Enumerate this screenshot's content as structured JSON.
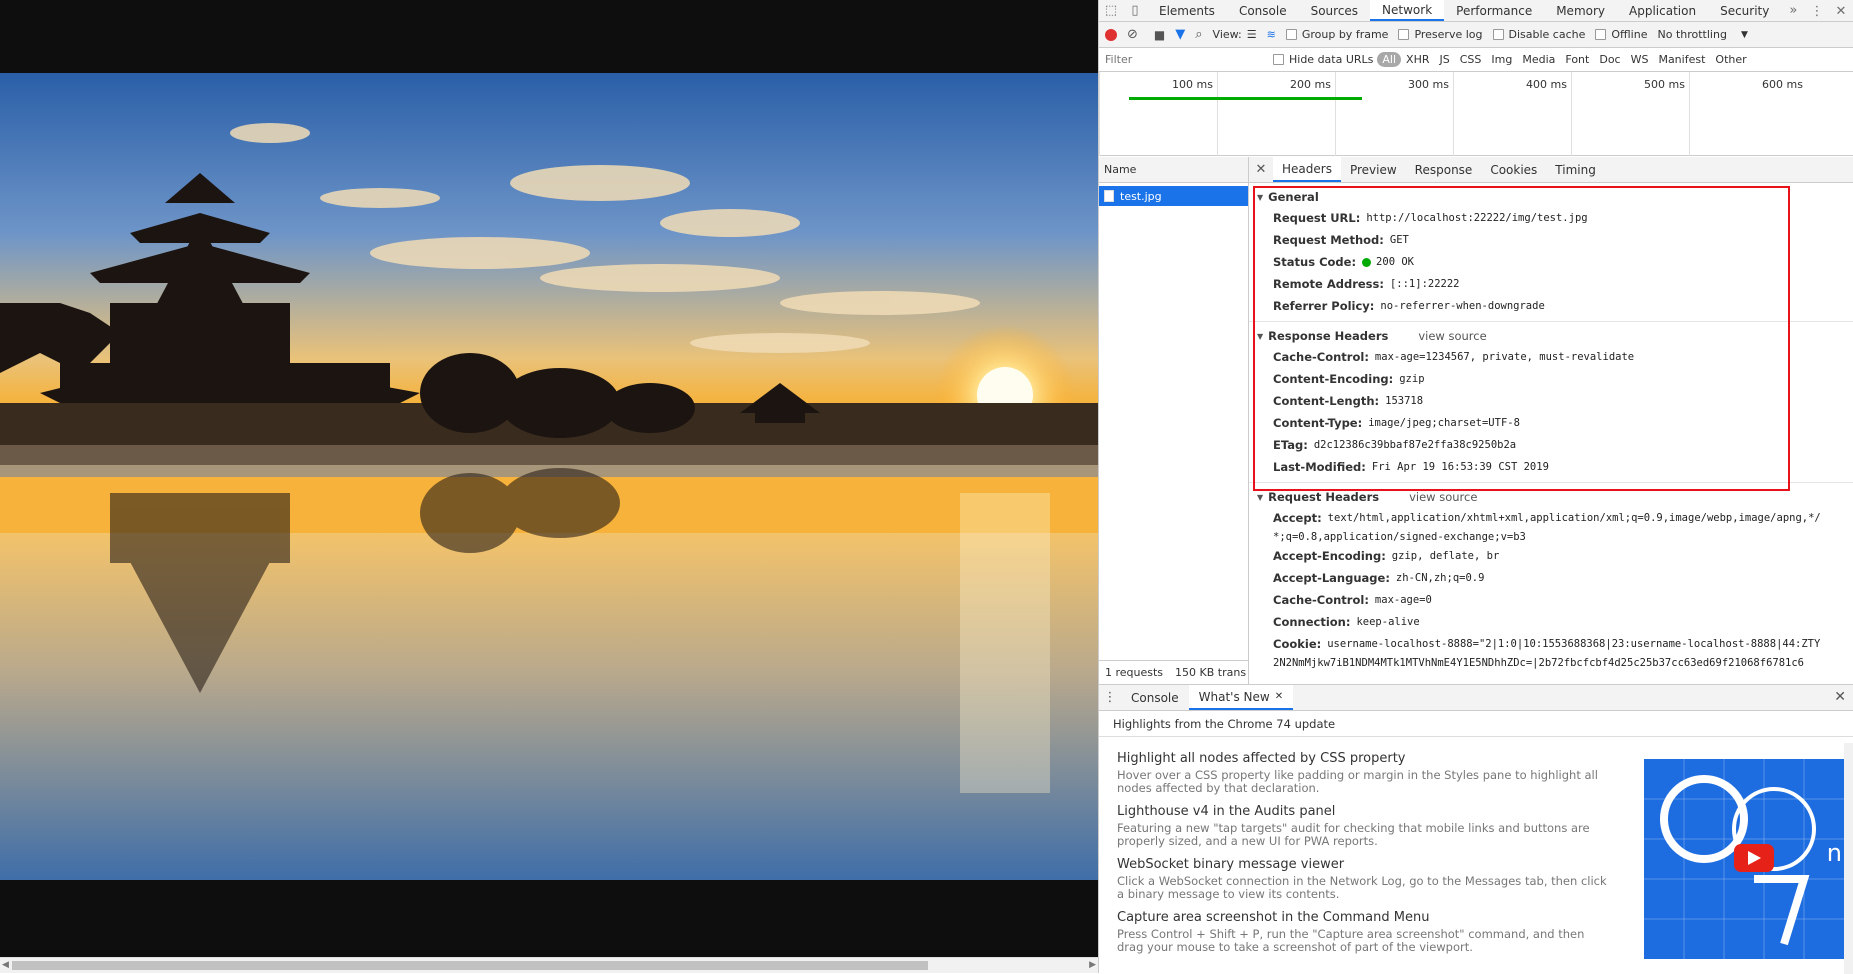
{
  "devtools": {
    "tabs": [
      "Elements",
      "Console",
      "Sources",
      "Network",
      "Performance",
      "Memory",
      "Application",
      "Security"
    ],
    "active_tab": "Network",
    "overflow": "»",
    "more": "⋮",
    "close": "✕",
    "toolbar": {
      "view_label": "View:",
      "group_by_frame": "Group by frame",
      "preserve_log": "Preserve log",
      "disable_cache": "Disable cache",
      "offline": "Offline",
      "throttling": "No throttling"
    },
    "filter": {
      "placeholder": "Filter",
      "hide_data_urls": "Hide data URLs",
      "types": [
        "All",
        "XHR",
        "JS",
        "CSS",
        "Img",
        "Media",
        "Font",
        "Doc",
        "WS",
        "Manifest",
        "Other"
      ]
    },
    "overview_ticks": [
      "100 ms",
      "200 ms",
      "300 ms",
      "400 ms",
      "500 ms",
      "600 ms"
    ],
    "requests": {
      "name_header": "Name",
      "rows": [
        {
          "name": "test.jpg"
        }
      ],
      "status": [
        "1 requests",
        "150 KB trans"
      ]
    },
    "detail_tabs": [
      "Headers",
      "Preview",
      "Response",
      "Cookies",
      "Timing"
    ],
    "active_detail_tab": "Headers",
    "general": {
      "title": "General",
      "rows": [
        {
          "key": "Request URL:",
          "value": "http://localhost:22222/img/test.jpg"
        },
        {
          "key": "Request Method:",
          "value": "GET"
        },
        {
          "key": "Status Code:",
          "value": "200 OK"
        },
        {
          "key": "Remote Address:",
          "value": "[::1]:22222"
        },
        {
          "key": "Referrer Policy:",
          "value": "no-referrer-when-downgrade"
        }
      ]
    },
    "response_headers": {
      "title": "Response Headers",
      "view_source": "view source",
      "rows": [
        {
          "key": "Cache-Control:",
          "value": "max-age=1234567, private, must-revalidate"
        },
        {
          "key": "Content-Encoding:",
          "value": "gzip"
        },
        {
          "key": "Content-Length:",
          "value": "153718"
        },
        {
          "key": "Content-Type:",
          "value": "image/jpeg;charset=UTF-8"
        },
        {
          "key": "ETag:",
          "value": "d2c12386c39bbaf87e2ffa38c9250b2a"
        },
        {
          "key": "Last-Modified:",
          "value": "Fri Apr 19 16:53:39 CST 2019"
        }
      ]
    },
    "request_headers": {
      "title": "Request Headers",
      "view_source": "view source",
      "accept_key": "Accept:",
      "accept_value": "text/html,application/xhtml+xml,application/xml;q=0.9,image/webp,image/apng,*/",
      "accept_cont": "*;q=0.8,application/signed-exchange;v=b3",
      "rows": [
        {
          "key": "Accept-Encoding:",
          "value": "gzip, deflate, br"
        },
        {
          "key": "Accept-Language:",
          "value": "zh-CN,zh;q=0.9"
        },
        {
          "key": "Cache-Control:",
          "value": "max-age=0"
        },
        {
          "key": "Connection:",
          "value": "keep-alive"
        }
      ],
      "cookie_key": "Cookie:",
      "cookie_value": "username-localhost-8888=\"2|1:0|10:1553688368|23:username-localhost-8888|44:ZTY",
      "cookie_cont": "2N2NmMjkw7iB1NDM4MTk1MTVhNmE4Y1E5NDhhZDc=|2b72fbcfcbf4d25c25b37cc63ed69f21068f6781c6"
    },
    "drawer": {
      "tabs": [
        "Console",
        "What's New"
      ],
      "active": "What's New",
      "tab_close": "✕",
      "highlights": "Highlights from the Chrome 74 update",
      "items": [
        {
          "title": "Highlight all nodes affected by CSS property",
          "desc": "Hover over a CSS property like padding or margin in the Styles pane to highlight all nodes affected by that declaration."
        },
        {
          "title": "Lighthouse v4 in the Audits panel",
          "desc": "Featuring a new \"tap targets\" audit for checking that mobile links and buttons are properly sized, and a new UI for PWA reports."
        },
        {
          "title": "WebSocket binary message viewer",
          "desc": "Click a WebSocket connection in the Network Log, go to the Messages tab, then click a binary message to view its contents."
        },
        {
          "title": "Capture area screenshot in the Command Menu",
          "desc": "Press Control + Shift + P, run the \"Capture area screenshot\" command, and then drag your mouse to take a screenshot of part of the viewport."
        }
      ],
      "video_digits": "97",
      "video_letter": "n"
    }
  },
  "colors": {
    "accent": "#1a73e8",
    "highlight_box": "#e8121b",
    "status_ok": "#00aa00",
    "record": "#e03131"
  }
}
